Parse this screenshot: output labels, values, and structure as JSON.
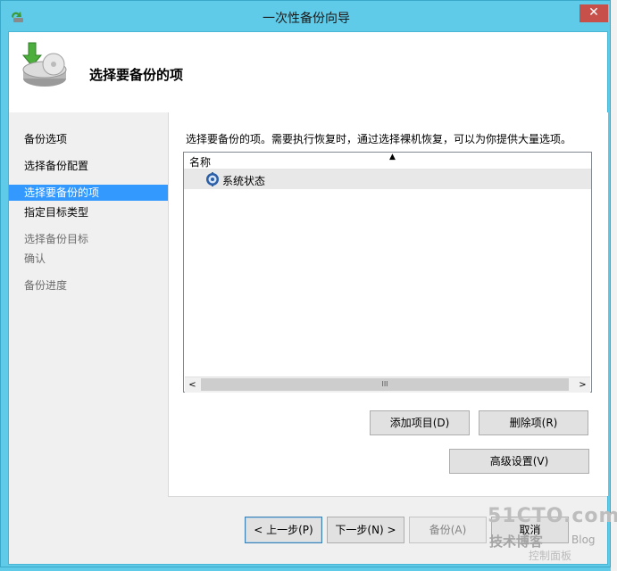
{
  "window": {
    "title": "一次性备份向导",
    "close_glyph": "✕",
    "title_icon": "backup-app-icon"
  },
  "header": {
    "title": "选择要备份的项",
    "icon": "backup-drive-arrow-icon"
  },
  "sidebar": {
    "items": [
      {
        "label": "备份选项",
        "state": "normal"
      },
      {
        "label": "选择备份配置",
        "state": "normal"
      },
      {
        "label": "选择要备份的项",
        "state": "active"
      },
      {
        "label": "指定目标类型",
        "state": "normal"
      },
      {
        "label": "选择备份目标",
        "state": "dim"
      },
      {
        "label": "确认",
        "state": "dim"
      },
      {
        "label": "备份进度",
        "state": "dim"
      }
    ]
  },
  "main": {
    "instruction": "选择要备份的项。需要执行恢复时，通过选择裸机恢复，可以为你提供大量选项。",
    "list": {
      "column_header": "名称",
      "sort_glyph": "▲",
      "rows": [
        {
          "label": "系统状态",
          "icon": "system-state-icon"
        }
      ],
      "scroll_left": "<",
      "scroll_right": ">",
      "scroll_thumb": "III"
    },
    "buttons": {
      "add": "添加项目(D)",
      "remove": "删除项(R)",
      "advanced": "高级设置(V)"
    }
  },
  "footer": {
    "back": "< 上一步(P)",
    "next": "下一步(N) >",
    "backup": "备份(A)",
    "cancel": "取消"
  },
  "watermark": {
    "main": "51CTO.com",
    "sub": "技术博客",
    "blog": "Blog",
    "tail": "控制面板"
  },
  "colors": {
    "titlebar": "#5fcbe8",
    "close": "#c7504b",
    "active_nav": "#3399ff"
  }
}
